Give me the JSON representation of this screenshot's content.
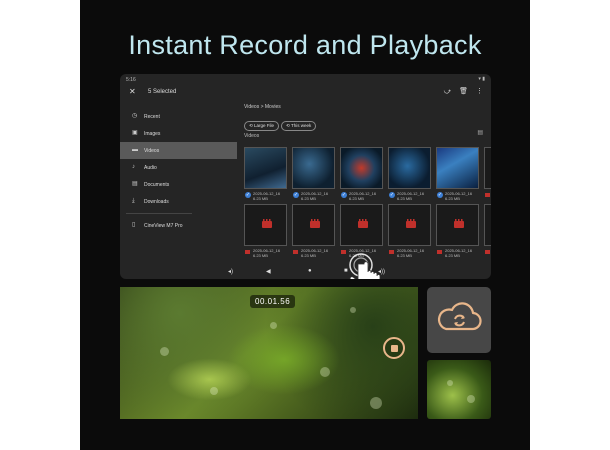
{
  "headline": "Instant Record and Playback",
  "tablet": {
    "status_time": "5:16",
    "status_icons": "▾ ▮",
    "close_icon": "✕",
    "selection_title": "5 Selected",
    "actions": [
      "share-icon",
      "delete-icon",
      "more-icon"
    ],
    "action_glyphs": [
      "⤻",
      "🗑",
      "⋮"
    ],
    "sidebar": [
      {
        "label": "Recent",
        "icon": "clock-icon",
        "glyph": "◷",
        "active": false
      },
      {
        "label": "Images",
        "icon": "image-icon",
        "glyph": "▣",
        "active": false
      },
      {
        "label": "Videos",
        "icon": "video-icon",
        "glyph": "▬",
        "active": true
      },
      {
        "label": "Audio",
        "icon": "audio-icon",
        "glyph": "♪",
        "active": false
      },
      {
        "label": "Documents",
        "icon": "document-icon",
        "glyph": "▤",
        "active": false
      },
      {
        "label": "Downloads",
        "icon": "download-icon",
        "glyph": "⤓",
        "active": false
      },
      {
        "label": "CineView M7 Pro",
        "icon": "device-icon",
        "glyph": "▯",
        "active": false
      }
    ],
    "breadcrumb": "Videos > Movies",
    "chips": [
      "Large File",
      "This week"
    ],
    "section_label": "Videos",
    "view_toggle": "▤",
    "files": [
      {
        "name": "2025-06-12_16",
        "size": "6.23 MB",
        "thumb": "v1",
        "selected": true
      },
      {
        "name": "2025-06-12_16",
        "size": "6.23 MB",
        "thumb": "v2",
        "selected": true
      },
      {
        "name": "2025-06-12_16",
        "size": "6.23 MB",
        "thumb": "v3",
        "selected": true
      },
      {
        "name": "2025-06-12_16",
        "size": "6.23 MB",
        "thumb": "v4",
        "selected": true
      },
      {
        "name": "2025-06-12_16",
        "size": "6.23 MB",
        "thumb": "v5",
        "selected": true
      },
      {
        "name": "2025-06-12_16",
        "size": "6.23 MB",
        "thumb": "red",
        "selected": false
      },
      {
        "name": "2025-06-12_16",
        "size": "6.23 MB",
        "thumb": "red",
        "selected": false
      },
      {
        "name": "2025-06-12_16",
        "size": "6.23 MB",
        "thumb": "red",
        "selected": false
      },
      {
        "name": "2025-06-12_16",
        "size": "6.23 MB",
        "thumb": "red",
        "selected": false
      },
      {
        "name": "2025-06-12_16",
        "size": "6.23 MB",
        "thumb": "red",
        "selected": false
      },
      {
        "name": "2025-06-12_16",
        "size": "6.23 MB",
        "thumb": "red",
        "selected": false
      },
      {
        "name": "2025-06-12_16",
        "size": "6.23 MB",
        "thumb": "red",
        "selected": false
      }
    ],
    "navbar": [
      "◂)",
      "◀",
      "●",
      "■",
      "◂))"
    ]
  },
  "recording": {
    "timer": "00.01.56"
  },
  "colors": {
    "accent": "#e8b68a",
    "headline": "#bfe6ee",
    "check": "#3c7fd6",
    "red": "#c0302b"
  }
}
